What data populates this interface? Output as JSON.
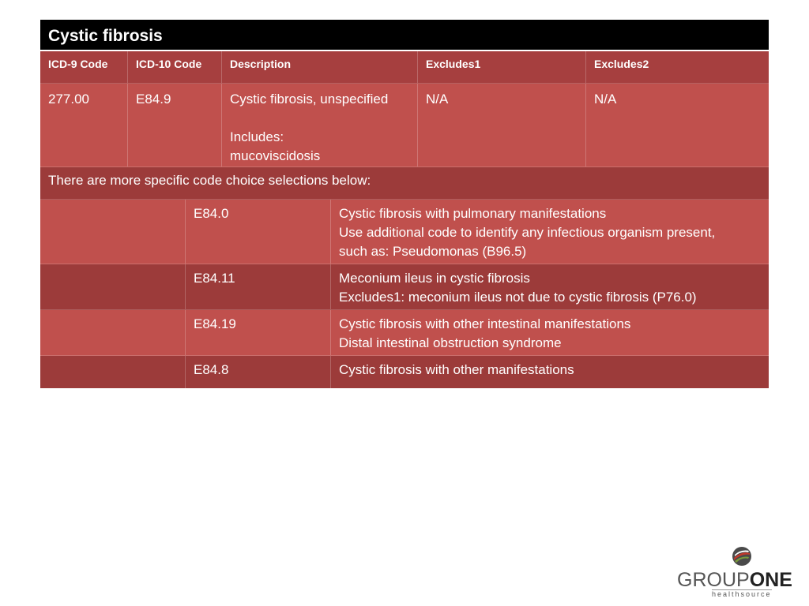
{
  "title": "Cystic fibrosis",
  "headers": [
    "ICD-9 Code",
    "ICD-10 Code",
    "Description",
    "Excludes1",
    "Excludes2"
  ],
  "main_row": {
    "icd9": "277.00",
    "icd10": "E84.9",
    "description_line1": "Cystic fibrosis, unspecified",
    "description_line2": "Includes:",
    "description_line3": "mucoviscidosis",
    "excludes1": "N/A",
    "excludes2": "N/A"
  },
  "note": "There are more specific code choice selections below:",
  "sub_rows": [
    {
      "code": "E84.0",
      "lines": [
        "Cystic fibrosis with pulmonary manifestations",
        "Use additional code to identify any infectious organism present,",
        "such as: Pseudomonas (B96.5)"
      ]
    },
    {
      "code": "E84.11",
      "lines": [
        "Meconium ileus in cystic fibrosis",
        "Excludes1: meconium ileus not due to cystic fibrosis (P76.0)"
      ]
    },
    {
      "code": "E84.19",
      "lines": [
        "Cystic fibrosis with other intestinal manifestations",
        "Distal intestinal obstruction syndrome"
      ]
    },
    {
      "code": "E84.8",
      "lines": [
        "Cystic fibrosis with other manifestations"
      ]
    }
  ],
  "logo": {
    "group": "GROUP",
    "one": "ONE",
    "sub": "healthsource"
  },
  "colors": {
    "title_bg": "#000000",
    "header_bg": "#a63f3f",
    "row_light": "#c0504d",
    "row_dark": "#9c3b3a"
  }
}
